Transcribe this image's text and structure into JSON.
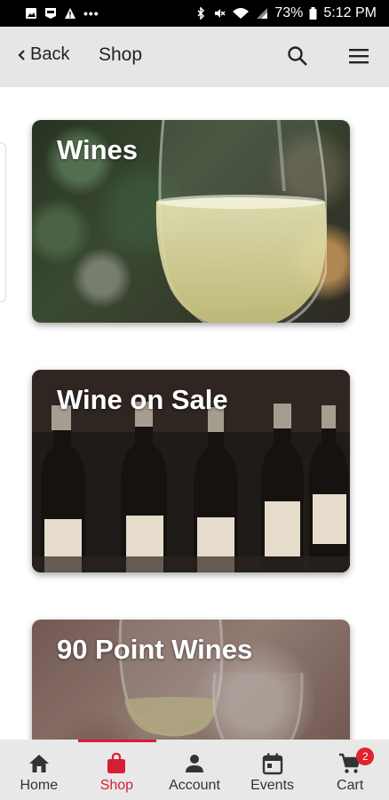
{
  "status_bar": {
    "battery_percent": "73%",
    "time": "5:12 PM",
    "icons": [
      "image-icon",
      "nfl-icon",
      "warning-icon",
      "more-dots-icon",
      "bluetooth-icon",
      "mute-icon",
      "wifi-icon",
      "signal-icon",
      "battery-icon"
    ]
  },
  "app_bar": {
    "back_label": "Back",
    "title": "Shop",
    "icons": [
      "search-icon",
      "menu-icon"
    ]
  },
  "cards": [
    {
      "title": "Wines"
    },
    {
      "title": "Wine on Sale"
    },
    {
      "title": "90 Point Wines"
    }
  ],
  "bottom_nav": {
    "active": "Shop",
    "accent_color": "#d51e34",
    "items": [
      {
        "label": "Home",
        "icon": "home-icon"
      },
      {
        "label": "Shop",
        "icon": "shopping-bag-icon"
      },
      {
        "label": "Account",
        "icon": "person-icon"
      },
      {
        "label": "Events",
        "icon": "calendar-icon"
      },
      {
        "label": "Cart",
        "icon": "cart-icon",
        "badge": "2"
      }
    ]
  }
}
